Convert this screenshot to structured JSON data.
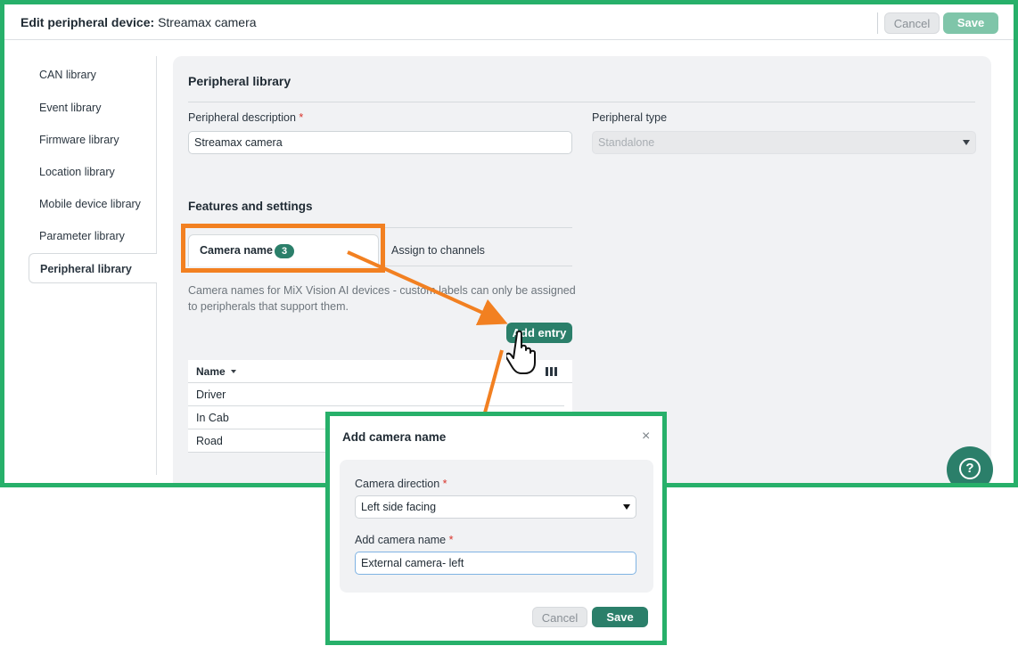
{
  "header": {
    "title_prefix": "Edit peripheral device:",
    "title_name": "Streamax camera",
    "cancel_label": "Cancel",
    "save_label": "Save"
  },
  "sidebar": {
    "items": [
      {
        "label": "CAN library"
      },
      {
        "label": "Event library"
      },
      {
        "label": "Firmware library"
      },
      {
        "label": "Location library"
      },
      {
        "label": "Mobile device library"
      },
      {
        "label": "Parameter library"
      },
      {
        "label": "Peripheral library",
        "active": true
      }
    ]
  },
  "main": {
    "section_title": "Peripheral library",
    "description_label": "Peripheral description",
    "description_value": "Streamax camera",
    "type_label": "Peripheral type",
    "type_value": "Standalone",
    "features_title": "Features and settings",
    "tabs": [
      {
        "label": "Camera name",
        "badge": "3",
        "active": true
      },
      {
        "label": "Assign to channels"
      }
    ],
    "hint": "Camera names for MiX Vision AI devices - custom labels can only be assigned to peripherals that support them.",
    "add_entry_label": "Add entry",
    "table": {
      "column": "Name",
      "rows": [
        "Driver",
        "In Cab",
        "Road"
      ]
    }
  },
  "help_icon": "?",
  "dialog": {
    "title": "Add camera name",
    "close_icon": "×",
    "direction_label": "Camera direction",
    "direction_value": "Left side facing",
    "name_label": "Add camera name",
    "name_value": "External camera- left",
    "cancel_label": "Cancel",
    "save_label": "Save"
  },
  "required_mark": "*",
  "colors": {
    "frame_green": "#27b06a",
    "brand_teal": "#2b7f6a",
    "annotation_orange": "#f28021"
  }
}
